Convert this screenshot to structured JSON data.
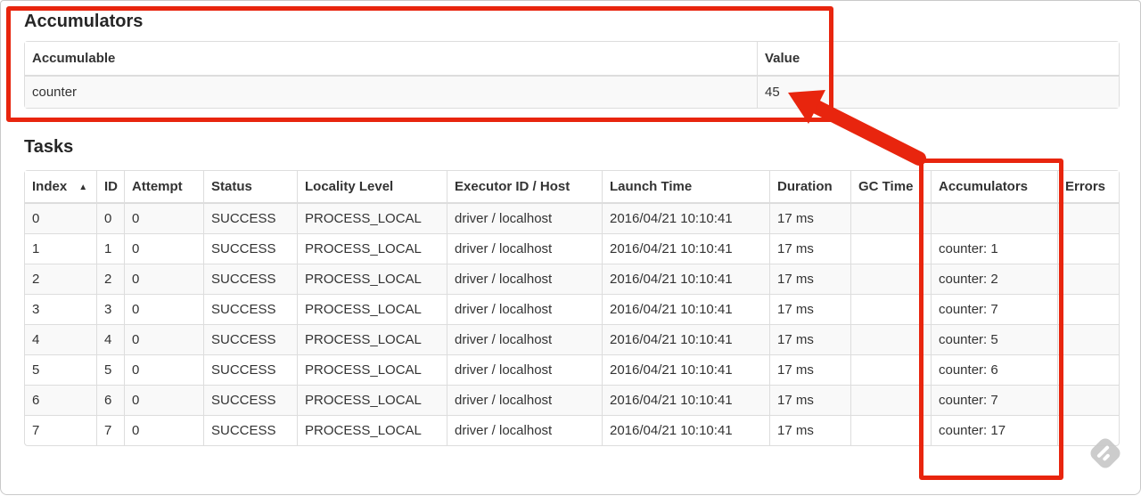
{
  "accumulators_section": {
    "title": "Accumulators",
    "table": {
      "headers": [
        "Accumulable",
        "Value"
      ],
      "rows": [
        [
          "counter",
          "45"
        ]
      ]
    }
  },
  "tasks_section": {
    "title": "Tasks",
    "sort_icon": "▲",
    "table": {
      "headers": [
        "Index",
        "ID",
        "Attempt",
        "Status",
        "Locality Level",
        "Executor ID / Host",
        "Launch Time",
        "Duration",
        "GC Time",
        "Accumulators",
        "Errors"
      ],
      "rows": [
        [
          "0",
          "0",
          "0",
          "SUCCESS",
          "PROCESS_LOCAL",
          "driver / localhost",
          "2016/04/21 10:10:41",
          "17 ms",
          "",
          "",
          ""
        ],
        [
          "1",
          "1",
          "0",
          "SUCCESS",
          "PROCESS_LOCAL",
          "driver / localhost",
          "2016/04/21 10:10:41",
          "17 ms",
          "",
          "counter: 1",
          ""
        ],
        [
          "2",
          "2",
          "0",
          "SUCCESS",
          "PROCESS_LOCAL",
          "driver / localhost",
          "2016/04/21 10:10:41",
          "17 ms",
          "",
          "counter: 2",
          ""
        ],
        [
          "3",
          "3",
          "0",
          "SUCCESS",
          "PROCESS_LOCAL",
          "driver / localhost",
          "2016/04/21 10:10:41",
          "17 ms",
          "",
          "counter: 7",
          ""
        ],
        [
          "4",
          "4",
          "0",
          "SUCCESS",
          "PROCESS_LOCAL",
          "driver / localhost",
          "2016/04/21 10:10:41",
          "17 ms",
          "",
          "counter: 5",
          ""
        ],
        [
          "5",
          "5",
          "0",
          "SUCCESS",
          "PROCESS_LOCAL",
          "driver / localhost",
          "2016/04/21 10:10:41",
          "17 ms",
          "",
          "counter: 6",
          ""
        ],
        [
          "6",
          "6",
          "0",
          "SUCCESS",
          "PROCESS_LOCAL",
          "driver / localhost",
          "2016/04/21 10:10:41",
          "17 ms",
          "",
          "counter: 7",
          ""
        ],
        [
          "7",
          "7",
          "0",
          "SUCCESS",
          "PROCESS_LOCAL",
          "driver / localhost",
          "2016/04/21 10:10:41",
          "17 ms",
          "",
          "counter: 17",
          ""
        ]
      ]
    }
  },
  "annotations": {
    "highlight_color": "#e8250e"
  }
}
